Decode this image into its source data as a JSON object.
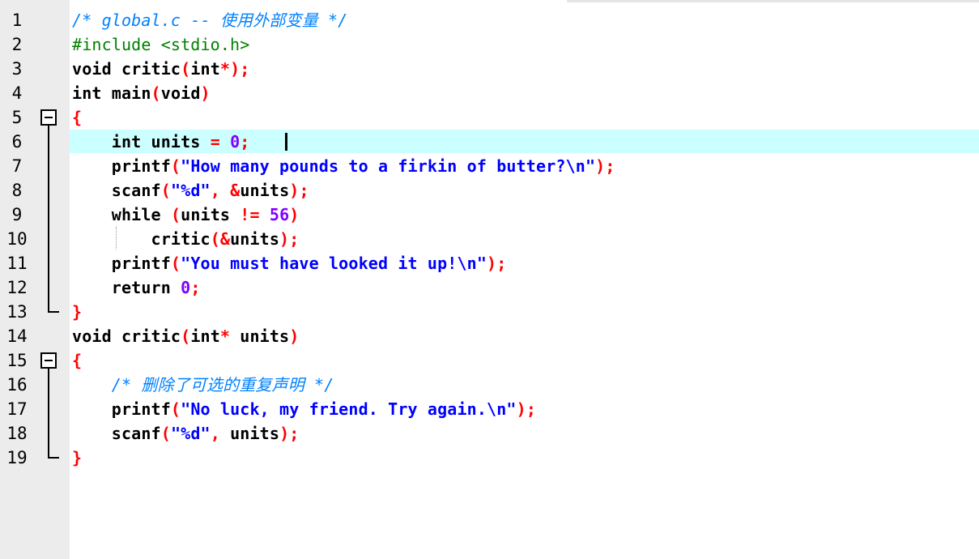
{
  "editor": {
    "lines": [
      {
        "n": "1",
        "tokens": [
          [
            "cm",
            "/* global.c -- 使用外部变量 */"
          ]
        ]
      },
      {
        "n": "2",
        "tokens": [
          [
            "pre",
            "#include <stdio.h>"
          ]
        ]
      },
      {
        "n": "3",
        "tokens": [
          [
            "kw",
            "void"
          ],
          [
            "id",
            " critic"
          ],
          [
            "op",
            "("
          ],
          [
            "kw",
            "int"
          ],
          [
            "op",
            "*);"
          ]
        ]
      },
      {
        "n": "4",
        "tokens": [
          [
            "kw",
            "int"
          ],
          [
            "id",
            " main"
          ],
          [
            "op",
            "("
          ],
          [
            "kw",
            "void"
          ],
          [
            "op",
            ")"
          ]
        ]
      },
      {
        "n": "5",
        "tokens": [
          [
            "op",
            "{"
          ]
        ]
      },
      {
        "n": "6",
        "tokens": [
          [
            "id",
            "    "
          ],
          [
            "kw",
            "int"
          ],
          [
            "id",
            " units "
          ],
          [
            "op",
            "="
          ],
          [
            "id",
            " "
          ],
          [
            "num",
            "0"
          ],
          [
            "op",
            ";"
          ],
          [
            "id",
            " "
          ]
        ]
      },
      {
        "n": "7",
        "tokens": [
          [
            "id",
            "    printf"
          ],
          [
            "op",
            "("
          ],
          [
            "str",
            "\"How many pounds to a firkin of butter?\\n\""
          ],
          [
            "op",
            ");"
          ]
        ]
      },
      {
        "n": "8",
        "tokens": [
          [
            "id",
            "    scanf"
          ],
          [
            "op",
            "("
          ],
          [
            "str",
            "\"%d\""
          ],
          [
            "op",
            ","
          ],
          [
            "id",
            " "
          ],
          [
            "op",
            "&"
          ],
          [
            "id",
            "units"
          ],
          [
            "op",
            ");"
          ]
        ]
      },
      {
        "n": "9",
        "tokens": [
          [
            "id",
            "    "
          ],
          [
            "kw",
            "while"
          ],
          [
            "id",
            " "
          ],
          [
            "op",
            "("
          ],
          [
            "id",
            "units "
          ],
          [
            "op",
            "!="
          ],
          [
            "id",
            " "
          ],
          [
            "num",
            "56"
          ],
          [
            "op",
            ")"
          ]
        ]
      },
      {
        "n": "10",
        "tokens": [
          [
            "id",
            "        critic"
          ],
          [
            "op",
            "(&"
          ],
          [
            "id",
            "units"
          ],
          [
            "op",
            ");"
          ]
        ]
      },
      {
        "n": "11",
        "tokens": [
          [
            "id",
            "    printf"
          ],
          [
            "op",
            "("
          ],
          [
            "str",
            "\"You must have looked it up!\\n\""
          ],
          [
            "op",
            ");"
          ]
        ]
      },
      {
        "n": "12",
        "tokens": [
          [
            "id",
            "    "
          ],
          [
            "kw",
            "return"
          ],
          [
            "id",
            " "
          ],
          [
            "num",
            "0"
          ],
          [
            "op",
            ";"
          ]
        ]
      },
      {
        "n": "13",
        "tokens": [
          [
            "op",
            "}"
          ]
        ]
      },
      {
        "n": "14",
        "tokens": [
          [
            "kw",
            "void"
          ],
          [
            "id",
            " critic"
          ],
          [
            "op",
            "("
          ],
          [
            "kw",
            "int"
          ],
          [
            "op",
            "*"
          ],
          [
            "id",
            " units"
          ],
          [
            "op",
            ")"
          ]
        ]
      },
      {
        "n": "15",
        "tokens": [
          [
            "op",
            "{"
          ]
        ]
      },
      {
        "n": "16",
        "tokens": [
          [
            "id",
            "    "
          ],
          [
            "cm",
            "/* 删除了可选的重复声明 */"
          ]
        ]
      },
      {
        "n": "17",
        "tokens": [
          [
            "id",
            "    printf"
          ],
          [
            "op",
            "("
          ],
          [
            "str",
            "\"No luck, my friend. Try again.\\n\""
          ],
          [
            "op",
            ");"
          ]
        ]
      },
      {
        "n": "18",
        "tokens": [
          [
            "id",
            "    scanf"
          ],
          [
            "op",
            "("
          ],
          [
            "str",
            "\"%d\""
          ],
          [
            "op",
            ","
          ],
          [
            "id",
            " units"
          ],
          [
            "op",
            ");"
          ]
        ]
      },
      {
        "n": "19",
        "tokens": [
          [
            "op",
            "}"
          ]
        ]
      }
    ],
    "current_line": 6,
    "fold_starts": [
      5,
      15
    ],
    "fold_ends": [
      13,
      19
    ],
    "colors": {
      "keyword": "#000000",
      "operator": "#ff0000",
      "number": "#8000ff",
      "string": "#0000ff",
      "preprocessor": "#008000",
      "comment": "#0080ff",
      "current_line_bg": "#ccffff",
      "gutter_bg": "#ececec"
    }
  }
}
